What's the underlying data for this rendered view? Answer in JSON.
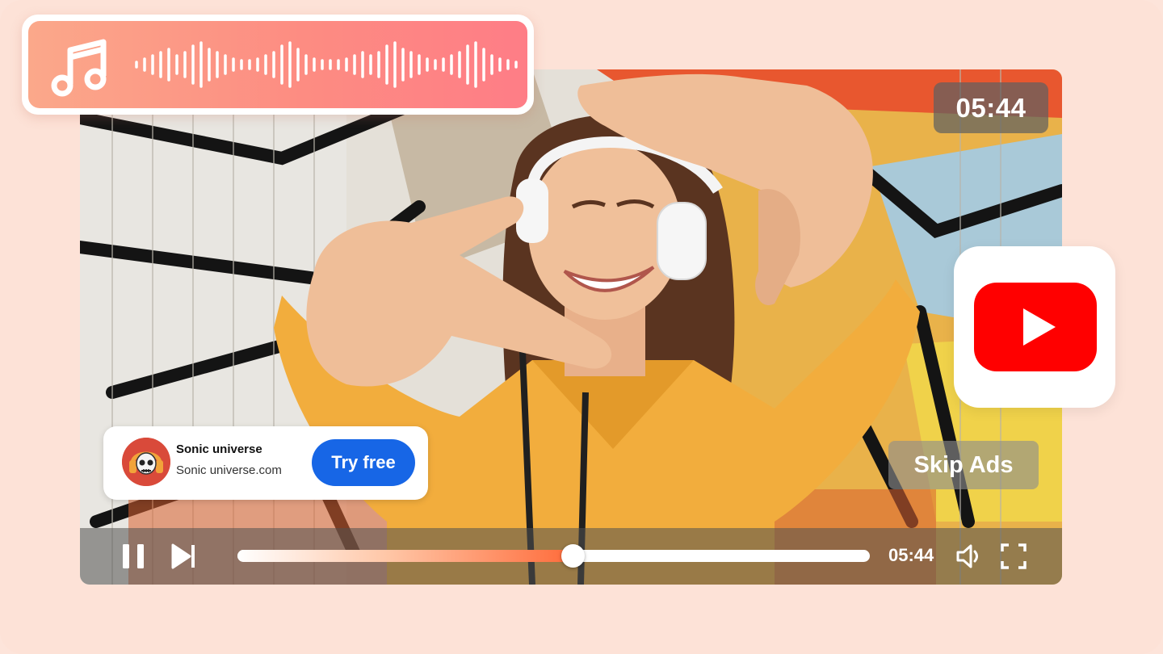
{
  "audio_panel": {
    "icon": "music-note-icon"
  },
  "video": {
    "duration_badge": "05:44",
    "skip_label": "Skip Ads"
  },
  "ad": {
    "name": "Sonic universe",
    "url": "Sonic universe.com",
    "cta_label": "Try free",
    "avatar_icon": "skull-headphones-icon"
  },
  "player": {
    "progress": 0.53,
    "current_time": "05:44",
    "icons": [
      "pause-icon",
      "skip-next-icon",
      "volume-icon",
      "fullscreen-icon"
    ]
  },
  "brand": {
    "icon": "youtube-logo-icon",
    "color": "#ff0000"
  },
  "colors": {
    "background": "#fde2d7",
    "accent_button": "#1766e6",
    "progress_accent": "#ff6b3a"
  }
}
